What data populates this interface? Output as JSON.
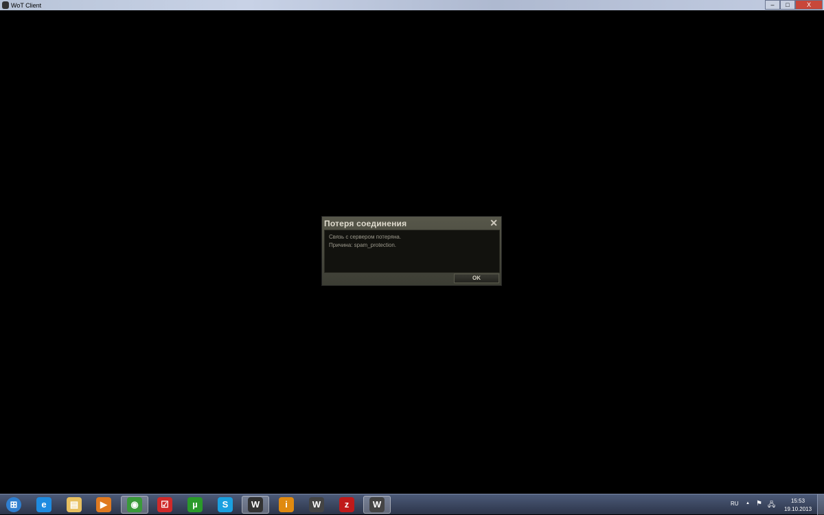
{
  "window": {
    "title": "WoT Client",
    "minimize": "–",
    "maximize": "□",
    "close": "X"
  },
  "dialog": {
    "title": "Потеря соединения",
    "line1": "Связь с сервером потеряна.",
    "line2": "Причина: spam_protection.",
    "ok": "OK",
    "close": "✕"
  },
  "taskbar": {
    "apps": [
      {
        "name": "start",
        "glyph": "⊞",
        "color": "#2f7fd0"
      },
      {
        "name": "internet-explorer",
        "glyph": "e",
        "color": "#1e8be0"
      },
      {
        "name": "file-explorer",
        "glyph": "▤",
        "color": "#e8c060"
      },
      {
        "name": "media-player",
        "glyph": "▶",
        "color": "#e07a20"
      },
      {
        "name": "chrome",
        "glyph": "◉",
        "color": "#3a9a3a"
      },
      {
        "name": "calendar",
        "glyph": "☑",
        "color": "#d02a2a"
      },
      {
        "name": "utorrent",
        "glyph": "µ",
        "color": "#2a9a2a"
      },
      {
        "name": "skype",
        "glyph": "S",
        "color": "#1aa0e0"
      },
      {
        "name": "wot-launcher",
        "glyph": "W",
        "color": "#333333"
      },
      {
        "name": "info",
        "glyph": "i",
        "color": "#e08a10"
      },
      {
        "name": "world-of-tanks",
        "glyph": "W",
        "color": "#444444"
      },
      {
        "name": "zynga",
        "glyph": "z",
        "color": "#c01a1a"
      },
      {
        "name": "wot-client",
        "glyph": "W",
        "color": "#444444"
      }
    ],
    "lang": "RU",
    "arrow": "▲",
    "flag": "⚑",
    "network": "🖧",
    "time": "15:53",
    "date": "19.10.2013"
  }
}
